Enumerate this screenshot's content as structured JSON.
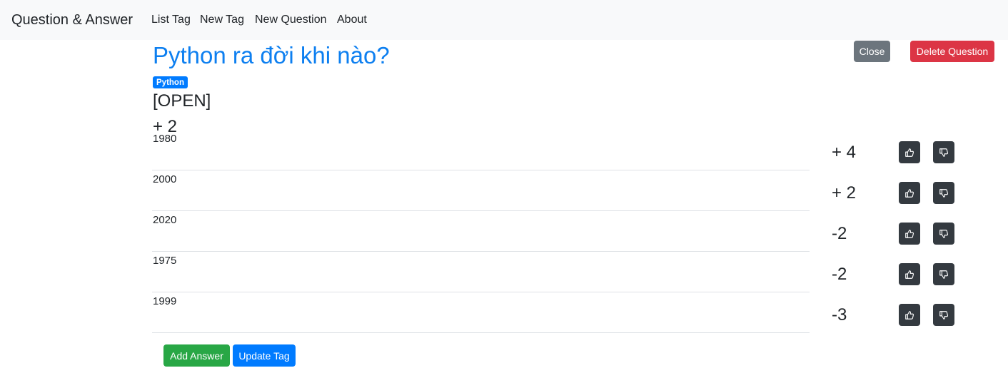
{
  "nav": {
    "brand": "Question & Answer",
    "links": [
      "List Tag",
      "New Tag",
      "New Question",
      "About"
    ]
  },
  "question": {
    "title": "Python ra đời khi nào?",
    "tag": "Python",
    "status": "[OPEN]",
    "score": "+ 2",
    "close_label": "Close",
    "delete_label": "Delete Question"
  },
  "answers": [
    {
      "text": "1980",
      "score": "+ 4"
    },
    {
      "text": "2000",
      "score": "+ 2"
    },
    {
      "text": "2020",
      "score": "-2"
    },
    {
      "text": "1975",
      "score": "-2"
    },
    {
      "text": "1999",
      "score": "-3"
    }
  ],
  "actions": {
    "add_answer_label": "Add Answer",
    "update_tag_label": "Update Tag"
  },
  "colors": {
    "title": "#0d7ff0",
    "primary": "#007bff",
    "danger": "#dc3545",
    "success": "#28a745",
    "secondary": "#6c757d",
    "dark": "#343a40"
  },
  "icons": {
    "upvote": "thumbs-up-icon",
    "downvote": "thumbs-down-icon"
  }
}
